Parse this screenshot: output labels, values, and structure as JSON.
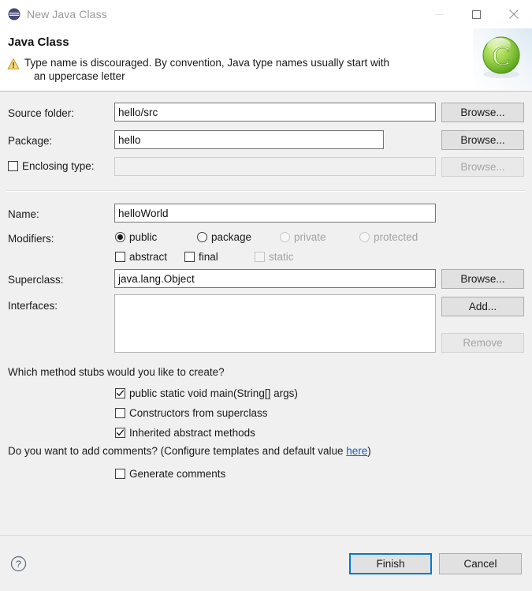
{
  "window": {
    "title": "New Java Class",
    "icon": "eclipse-wizard-icon",
    "minimize_label": "Minimize",
    "maximize_label": "Maximize",
    "close_label": "Close"
  },
  "header": {
    "title": "Java Class",
    "message_line1": "Type name is discouraged. By convention, Java type names usually start with",
    "message_line2": "an uppercase letter",
    "status_icon": "warning-icon",
    "banner_icon": "green-class-logo"
  },
  "form": {
    "source_folder": {
      "label": "Source folder:",
      "value": "hello/src",
      "placeholder": "",
      "browse_label": "Browse..."
    },
    "package": {
      "label": "Package:",
      "value": "hello",
      "placeholder": "",
      "browse_label": "Browse..."
    },
    "enclosing_type": {
      "label": "Enclosing type:",
      "value": "",
      "placeholder": "",
      "checked": false,
      "browse_label": "Browse...",
      "enabled": false
    },
    "name": {
      "label": "Name:",
      "value": "helloWorld",
      "placeholder": ""
    },
    "modifiers": {
      "label": "Modifiers:",
      "access": [
        {
          "label": "public",
          "selected": true,
          "enabled": true
        },
        {
          "label": "package",
          "selected": false,
          "enabled": true
        },
        {
          "label": "private",
          "selected": false,
          "enabled": false
        },
        {
          "label": "protected",
          "selected": false,
          "enabled": false
        }
      ],
      "flags": [
        {
          "label": "abstract",
          "checked": false,
          "enabled": true
        },
        {
          "label": "final",
          "checked": false,
          "enabled": true
        },
        {
          "label": "static",
          "checked": false,
          "enabled": false
        }
      ]
    },
    "superclass": {
      "label": "Superclass:",
      "value": "java.lang.Object",
      "browse_label": "Browse..."
    },
    "interfaces": {
      "label": "Interfaces:",
      "items": [],
      "add_label": "Add...",
      "remove_label": "Remove",
      "remove_enabled": false
    }
  },
  "stubs": {
    "question": "Which method stubs would you like to create?",
    "options": [
      {
        "label": "public static void main(String[] args)",
        "checked": true
      },
      {
        "label": "Constructors from superclass",
        "checked": false
      },
      {
        "label": "Inherited abstract methods",
        "checked": true
      }
    ]
  },
  "comments": {
    "question_prefix": "Do you want to add comments? (Configure templates and default value ",
    "link_label": "here",
    "question_suffix": ")",
    "generate": {
      "label": "Generate comments",
      "checked": false
    }
  },
  "footer": {
    "help_label": "?",
    "finish_label": "Finish",
    "cancel_label": "Cancel",
    "default_button": "Finish"
  },
  "colors": {
    "dialog_bg": "#f0f0f0",
    "header_bg": "#ffffff",
    "accent_focus": "#0078d7",
    "link": "#1a5fb4",
    "warning": "#e8b33c",
    "logo_green": "#7ac943",
    "disabled_text": "#a3a3a3"
  }
}
